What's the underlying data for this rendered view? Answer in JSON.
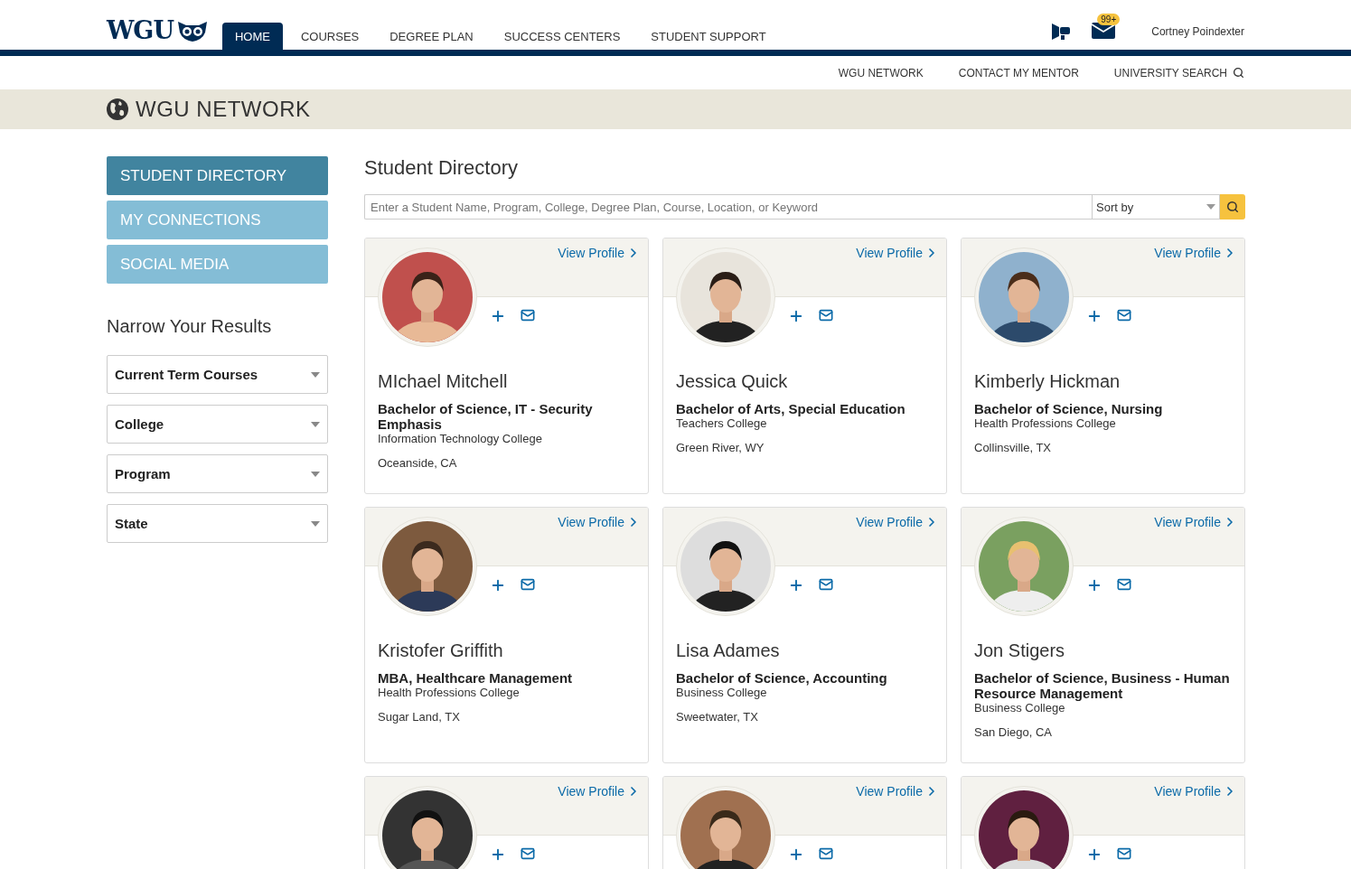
{
  "header": {
    "logo": "WGU",
    "nav": [
      {
        "label": "HOME",
        "selected": true
      },
      {
        "label": "COURSES",
        "selected": false
      },
      {
        "label": "DEGREE PLAN",
        "selected": false
      },
      {
        "label": "SUCCESS CENTERS",
        "selected": false
      },
      {
        "label": "STUDENT SUPPORT",
        "selected": false
      }
    ],
    "badge": "99+",
    "user": "Cortney Poindexter"
  },
  "subnav": [
    "WGU NETWORK",
    "CONTACT MY MENTOR",
    "UNIVERSITY SEARCH"
  ],
  "banner": {
    "title": "WGU NETWORK"
  },
  "sidebar": {
    "menu": [
      {
        "label": "STUDENT DIRECTORY",
        "selected": true
      },
      {
        "label": "MY CONNECTIONS",
        "selected": false
      },
      {
        "label": "SOCIAL MEDIA",
        "selected": false
      }
    ],
    "filters_title": "Narrow Your Results",
    "filters": [
      "Current Term Courses",
      "College",
      "Program",
      "State"
    ]
  },
  "directory": {
    "title": "Student Directory",
    "search_placeholder": "Enter a Student Name, Program, College, Degree Plan, Course, Location, or Keyword",
    "sort": "Sort by",
    "cards": [
      {
        "link": "View Profile",
        "name": "MIchael Mitchell",
        "program": "Bachelor of Science, IT - Security Emphasis",
        "college": "Information Technology College",
        "location": "Oceanside, CA"
      },
      {
        "link": "View Profile",
        "name": "Jessica Quick",
        "program": "Bachelor of Arts, Special Education",
        "college": "Teachers College",
        "location": "Green River, WY"
      },
      {
        "link": "View Profile",
        "name": "Kimberly Hickman",
        "program": "Bachelor of Science, Nursing",
        "college": "Health Professions College",
        "location": "Collinsville, TX"
      },
      {
        "link": "View Profile",
        "name": "Kristofer Griffith",
        "program": "MBA, Healthcare Management",
        "college": "Health Professions College",
        "location": "Sugar Land, TX"
      },
      {
        "link": "View Profile",
        "name": "Lisa Adames",
        "program": "Bachelor of Science, Accounting",
        "college": "Business College",
        "location": "Sweetwater, TX"
      },
      {
        "link": "View Profile",
        "name": "Jon Stigers",
        "program": "Bachelor of Science, Business - Human Resource Management",
        "college": "Business College",
        "location": "San Diego, CA"
      },
      {
        "link": "View Profile"
      },
      {
        "link": "View Profile"
      },
      {
        "link": "View Profile"
      }
    ]
  }
}
